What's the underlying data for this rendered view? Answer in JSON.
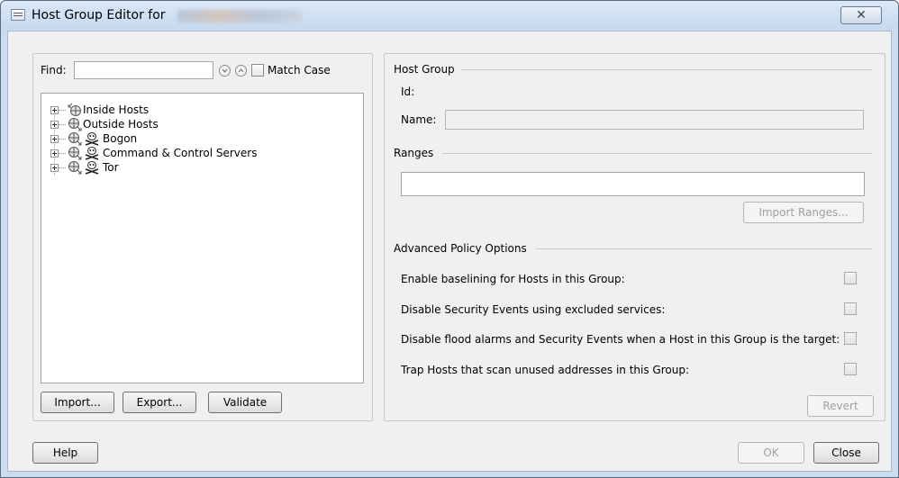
{
  "window": {
    "title": "Host Group Editor for",
    "close_glyph": "✕"
  },
  "find": {
    "label": "Find:",
    "value": "",
    "match_case_label": "Match Case",
    "match_case_checked": false
  },
  "tree": {
    "items": [
      {
        "label": "Inside Hosts",
        "icon": "inside-hosts-icon"
      },
      {
        "label": "Outside Hosts",
        "icon": "globe-icon"
      },
      {
        "label": "Bogon",
        "icon": "skull-crossbones-icon"
      },
      {
        "label": "Command & Control Servers",
        "icon": "skull-crossbones-icon"
      },
      {
        "label": "Tor",
        "icon": "skull-crossbones-icon"
      }
    ]
  },
  "left_buttons": {
    "import": "Import...",
    "export": "Export...",
    "validate": "Validate"
  },
  "host_group": {
    "section_title": "Host Group",
    "id_label": "Id:",
    "id_value": "",
    "name_label": "Name:",
    "name_value": ""
  },
  "ranges": {
    "section_title": "Ranges",
    "value": "",
    "import_button": "Import Ranges..."
  },
  "advanced": {
    "section_title": "Advanced Policy Options",
    "options": [
      {
        "label": "Enable baselining for Hosts in this Group:",
        "checked": false
      },
      {
        "label": "Disable Security Events using excluded services:",
        "checked": false
      },
      {
        "label": "Disable flood alarms and Security Events when a Host in this Group is the target:",
        "checked": false
      },
      {
        "label": "Trap Hosts that scan unused addresses in this Group:",
        "checked": false
      }
    ],
    "revert_button": "Revert"
  },
  "footer": {
    "help": "Help",
    "ok": "OK",
    "close": "Close"
  }
}
